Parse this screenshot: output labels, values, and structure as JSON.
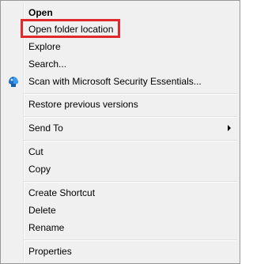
{
  "menu": {
    "open": "Open",
    "open_folder_location": "Open folder location",
    "explore": "Explore",
    "search": "Search...",
    "scan_mse": "Scan with Microsoft Security Essentials...",
    "restore_previous_versions": "Restore previous versions",
    "send_to": "Send To",
    "cut": "Cut",
    "copy": "Copy",
    "create_shortcut": "Create Shortcut",
    "delete": "Delete",
    "rename": "Rename",
    "properties": "Properties"
  },
  "icons": {
    "scan": "microsoft-security-essentials-icon",
    "submenu": "submenu-arrow-icon"
  },
  "colors": {
    "menu_background": "#f0f0f0",
    "highlight_border": "#e0282d"
  }
}
